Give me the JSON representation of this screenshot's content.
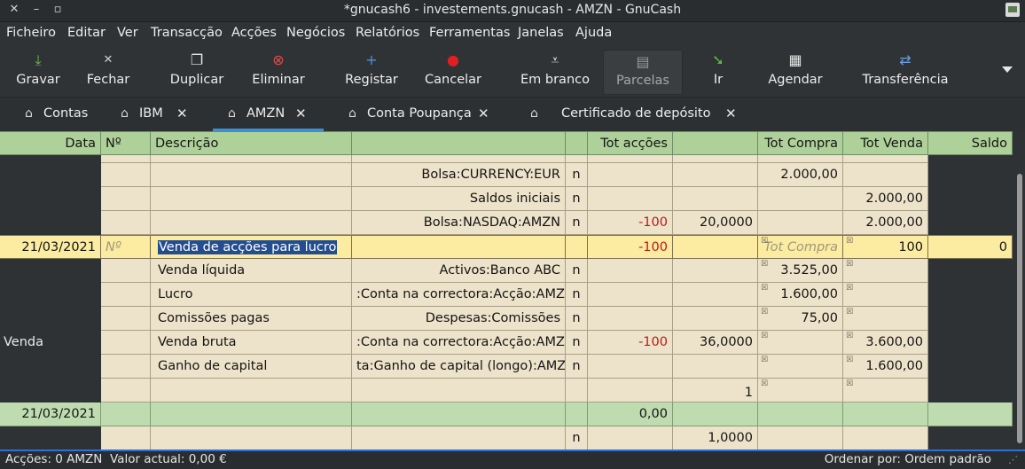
{
  "window": {
    "title": "*gnucash6 - investements.gnucash - AMZN - GnuCash"
  },
  "menu": [
    "Ficheiro",
    "Editar",
    "Ver",
    "Transacção",
    "Acções",
    "Negócios",
    "Relatórios",
    "Ferramentas",
    "Janelas",
    "Ajuda"
  ],
  "toolbar": {
    "gravar": "Gravar",
    "fechar": "Fechar",
    "duplicar": "Duplicar",
    "eliminar": "Eliminar",
    "registar": "Registar",
    "cancelar": "Cancelar",
    "em_branco": "Em branco",
    "parcelas": "Parcelas",
    "ir": "Ir",
    "agendar": "Agendar",
    "transferencia": "Transferência"
  },
  "tabs": [
    "Contas",
    "IBM",
    "AMZN",
    "Conta Poupança",
    "Certificado de depósito"
  ],
  "header": {
    "data": "Data",
    "num": "Nº",
    "descricao": "Descrição",
    "tot_accoes": "Tot acções",
    "tot_compra": "Tot Compra",
    "tot_venda": "Tot Venda",
    "saldo": "Saldo"
  },
  "rows": [
    {
      "account": "Bolsa:CURRENCY:EUR",
      "r": "n",
      "compra": "2.000,00"
    },
    {
      "account": "Saldos iniciais",
      "r": "n",
      "venda": "2.000,00"
    },
    {
      "account": "Bolsa:NASDAQ:AMZN",
      "r": "n",
      "acoes": "-100",
      "preco": "20,0000",
      "venda": "2.000,00"
    }
  ],
  "current": {
    "date": "21/03/2021",
    "num_placeholder": "Nº",
    "description": "Venda de acções para lucro",
    "acoes": "-100",
    "compra_placeholder": "Tot Compra",
    "venda": "100",
    "saldo": "0"
  },
  "splits": [
    {
      "action": "",
      "memo": "Venda líquida",
      "account": "Activos:Banco ABC",
      "r": "n",
      "compra": "3.525,00"
    },
    {
      "action": "",
      "memo": "Lucro",
      "account": ":Conta na correctora:Acção:AMZN",
      "r": "n",
      "compra": "1.600,00"
    },
    {
      "action": "",
      "memo": "Comissões pagas",
      "account": "Despesas:Comissões",
      "r": "n",
      "compra": "75,00"
    },
    {
      "action": "Venda",
      "memo": "Venda bruta",
      "account": ":Conta na correctora:Acção:AMZN",
      "r": "n",
      "acoes": "-100",
      "preco": "36,0000",
      "venda": "3.600,00"
    },
    {
      "action": "",
      "memo": "Ganho de capital",
      "account": "ta:Ganho de capital (longo):AMZN",
      "r": "n",
      "venda": "1.600,00"
    },
    {
      "action": "",
      "memo": "",
      "account": "",
      "r": "",
      "preco": "1"
    }
  ],
  "blank": {
    "date": "21/03/2021",
    "acoes": "0,00"
  },
  "blank_split": {
    "r": "n",
    "preco": "1,0000"
  },
  "status": {
    "accoes": "Acções: 0 AMZN",
    "valor": "Valor actual: 0,00 €",
    "ordenar": "Ordenar por: Ordem padrão"
  },
  "colors": {
    "header": "#aed19a",
    "current": "#fbeca1",
    "split": "#ede3ca",
    "negative": "#c01818",
    "tab_accent": "#3c8fd6"
  }
}
